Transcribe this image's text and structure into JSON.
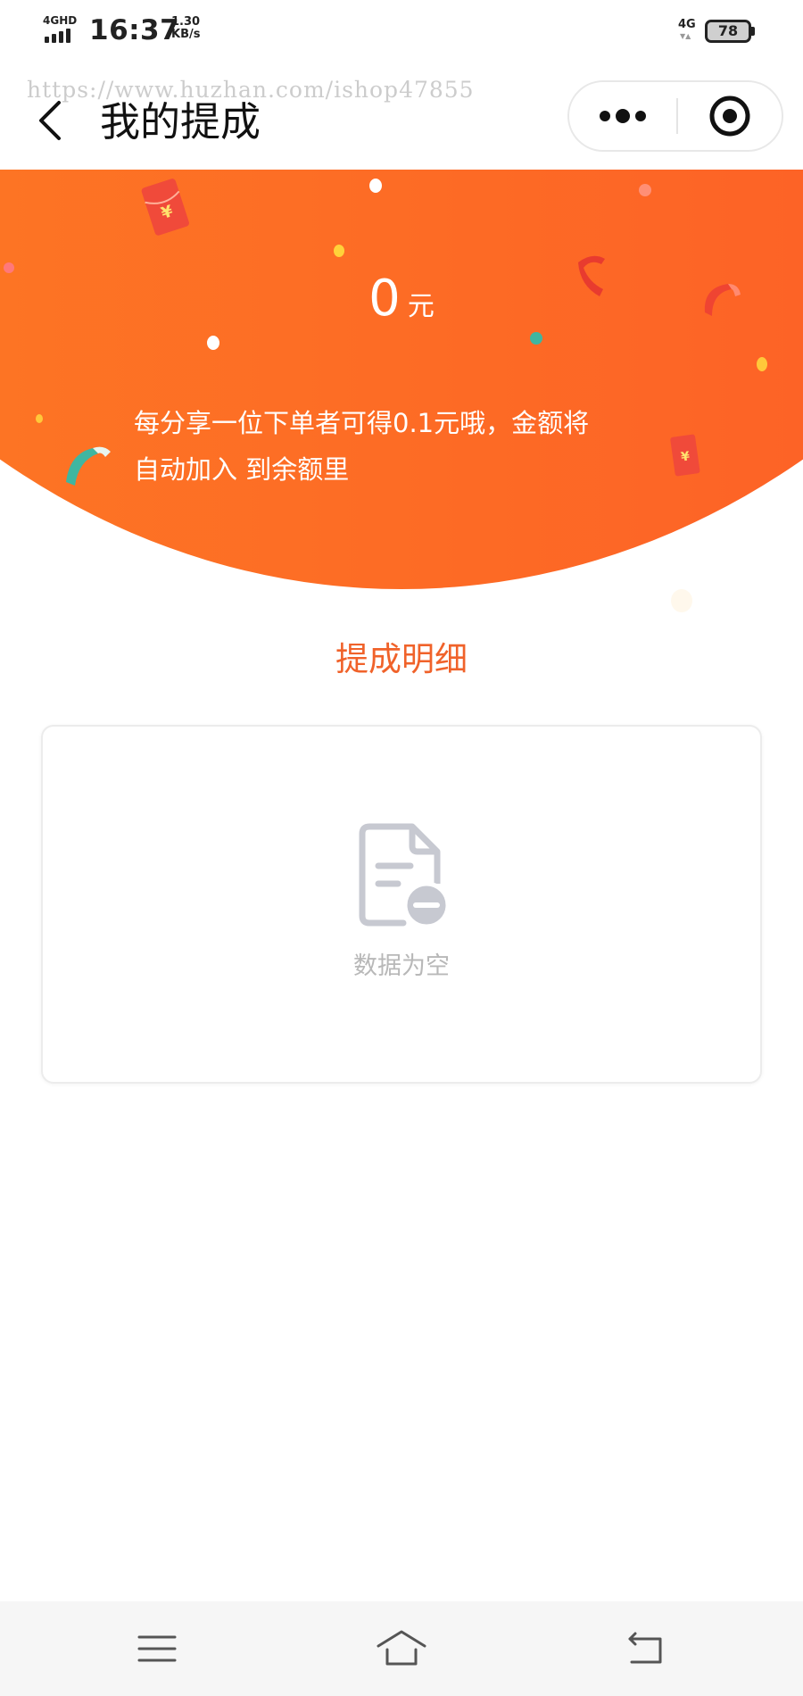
{
  "status_bar": {
    "network_label": "4GHD",
    "time": "16:37",
    "speed_value": "1.30",
    "speed_unit": "KB/s",
    "network_right": "4G",
    "battery_level": "78"
  },
  "nav": {
    "watermark": "https://www.huzhan.com/ishop47855",
    "title": "我的提成",
    "icons": {
      "back": "chevron-left-icon",
      "more": "more-dots-icon",
      "close": "target-circle-icon"
    }
  },
  "hero": {
    "amount_value": "0",
    "amount_unit": "元",
    "description_line1": "每分享一位下单者可得0.1元哦，金额将",
    "description_line2": "自动加入 到余额里",
    "gradient_start": "#fd7c24",
    "gradient_end": "#fd5a28"
  },
  "detail": {
    "title": "提成明细",
    "empty_text": "数据为空",
    "empty_icon": "document-minus-icon"
  },
  "system_nav": {
    "icons": [
      "menu-icon",
      "home-icon",
      "back-icon"
    ]
  },
  "colors": {
    "accent": "#f0622a",
    "muted_text": "#b8b8b8"
  }
}
